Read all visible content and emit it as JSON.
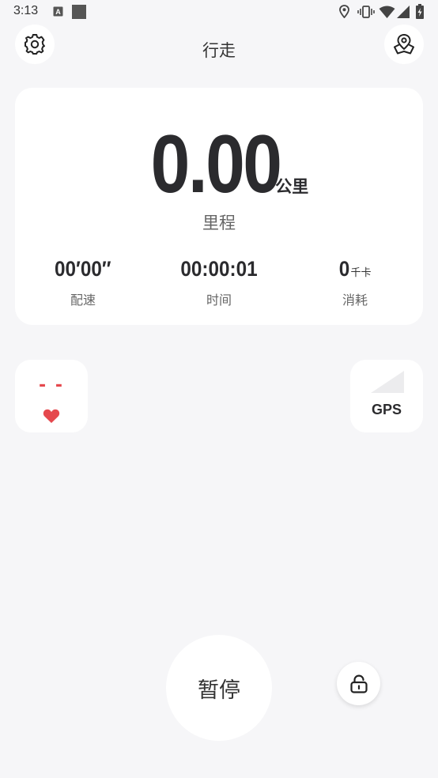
{
  "status_bar": {
    "time": "3:13"
  },
  "header": {
    "title": "行走",
    "settings_icon": "gear-icon",
    "map_icon": "map-pin-icon"
  },
  "stats": {
    "distance": {
      "value": "0.00",
      "unit": "公里",
      "label": "里程"
    },
    "pace": {
      "value": "00′00″",
      "label": "配速"
    },
    "time": {
      "value": "00:00:01",
      "label": "时间"
    },
    "calories": {
      "value": "0",
      "unit": "千卡",
      "label": "消耗"
    }
  },
  "heart_rate": {
    "value": "- -",
    "icon": "heart-icon",
    "color": "#e5484d"
  },
  "gps": {
    "label": "GPS",
    "icon": "signal-icon"
  },
  "controls": {
    "pause_label": "暂停",
    "lock_icon": "unlock-icon"
  }
}
